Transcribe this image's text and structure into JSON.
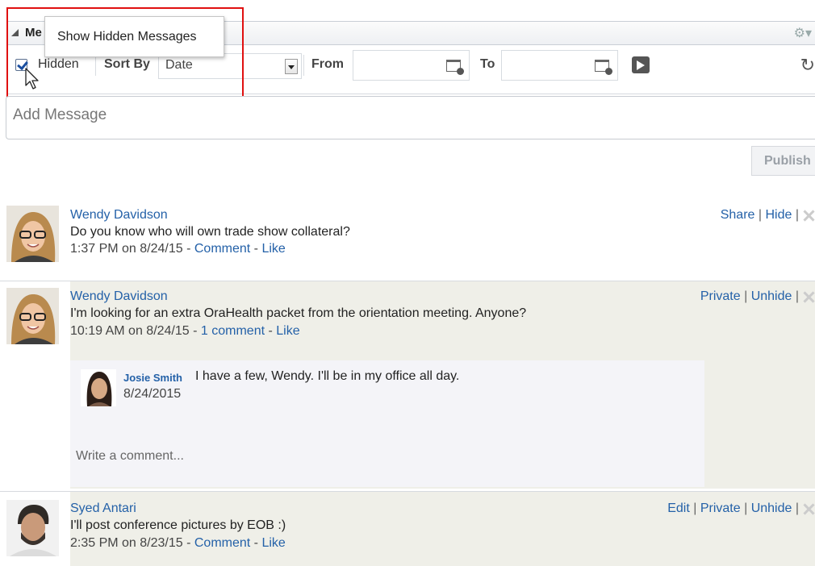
{
  "panel": {
    "title": "Me",
    "settings_icon": "gear-icon"
  },
  "tooltip": {
    "text": "Show Hidden Messages"
  },
  "toolbar": {
    "hidden_label": "Hidden",
    "hidden_checked": true,
    "sort_by_label": "Sort By",
    "sort_value": "Date",
    "from_label": "From",
    "to_label": "To",
    "go_icon": "arrow-right-icon",
    "refresh_icon": "refresh-icon"
  },
  "composer": {
    "placeholder": "Add Message",
    "publish_label": "Publish"
  },
  "messages": [
    {
      "author": "Wendy Davidson",
      "text": "Do you know who will own trade show collateral?",
      "time": "1:37 PM on 8/24/15 - ",
      "comment_label": "Comment",
      "like_label": "Like",
      "actions": [
        "Share",
        "Hide"
      ],
      "hidden": false
    },
    {
      "author": "Wendy Davidson",
      "text": "I'm looking for an extra OraHealth packet from the orientation meeting. Anyone?",
      "time": "10:19 AM on 8/24/15 - ",
      "comment_label": "1 comment",
      "like_label": "Like",
      "actions": [
        "Private",
        "Unhide"
      ],
      "hidden": true,
      "replies": [
        {
          "author": "Josie Smith",
          "text": "I have a few, Wendy. I'll be in my office all day.",
          "date": "8/24/2015"
        }
      ],
      "comment_placeholder": "Write a comment..."
    },
    {
      "author": "Syed Antari",
      "text": "I'll post conference pictures by EOB :)",
      "time": "2:35 PM on 8/23/15 - ",
      "comment_label": "Comment",
      "like_label": "Like",
      "actions": [
        "Edit",
        "Private",
        "Unhide"
      ],
      "hidden": true
    }
  ],
  "colors": {
    "link": "#2461a8",
    "hidden_bg": "#efefe8",
    "highlight": "#e01010"
  }
}
